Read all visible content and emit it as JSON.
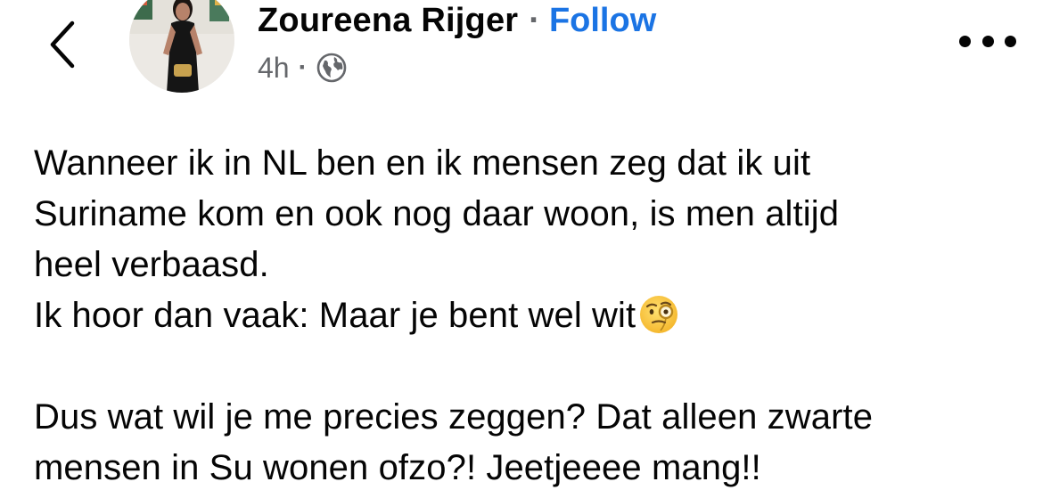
{
  "header": {
    "back_icon": "chevron-left-icon",
    "author_name": "Zoureena Rijger",
    "separator": "·",
    "follow_label": "Follow",
    "timestamp": "4h",
    "meta_separator": "·",
    "audience_icon": "globe-icon",
    "more_icon": "more-horizontal-icon"
  },
  "post": {
    "lines": [
      "Wanneer ik in NL ben en ik mensen zeg dat ik uit",
      "Suriname kom en ook nog daar woon, is men altijd",
      "heel verbaasd.",
      "Ik hoor dan vaak: Maar je bent wel wit",
      "",
      "Dus wat wil je me precies zeggen? Dat alleen zwarte",
      "mensen in Su wonen ofzo?! Jeetjeeee mang!!"
    ],
    "emoji": "face-with-monocle"
  },
  "colors": {
    "text": "#050505",
    "secondary": "#65676b",
    "link": "#1b74e4",
    "background": "#ffffff"
  }
}
